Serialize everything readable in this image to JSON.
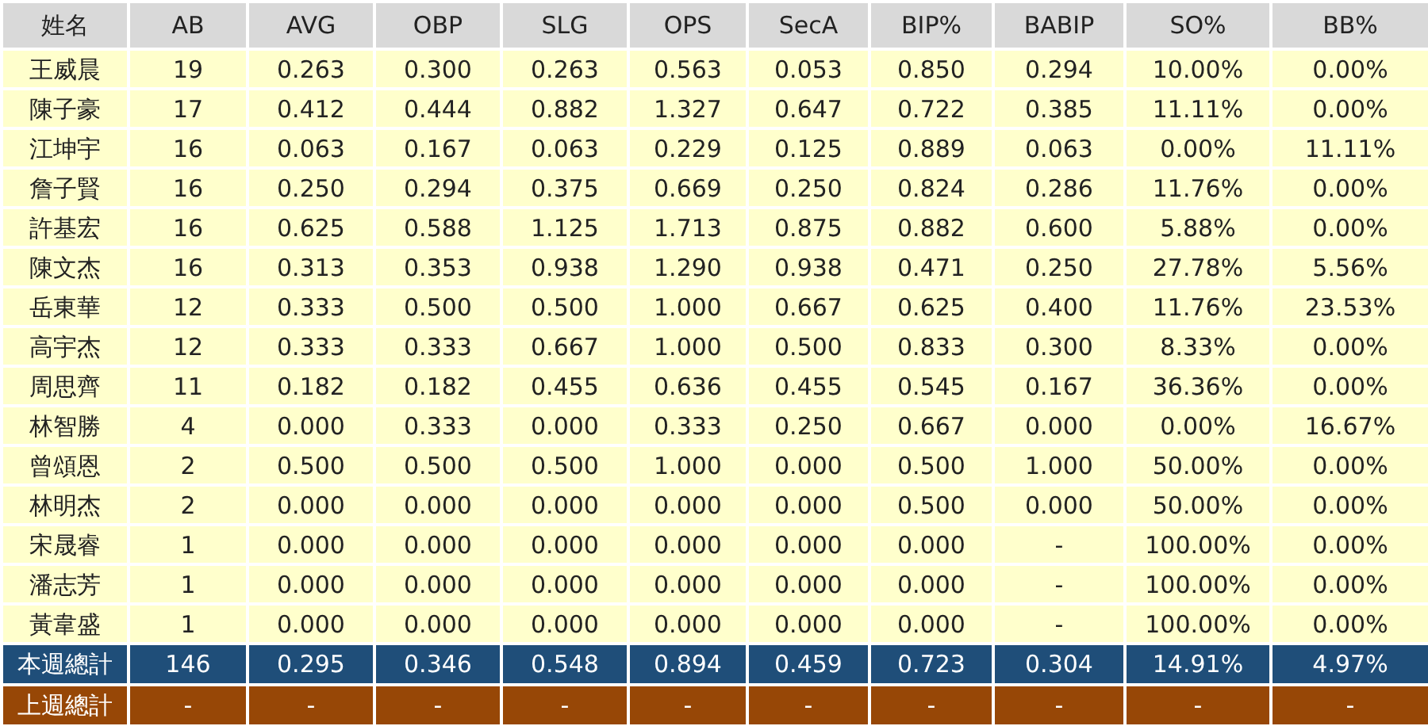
{
  "table": {
    "columns": [
      "姓名",
      "AB",
      "AVG",
      "OBP",
      "SLG",
      "OPS",
      "SecA",
      "BIP%",
      "BABIP",
      "SO%",
      "BB%"
    ],
    "rows": [
      [
        "王威晨",
        "19",
        "0.263",
        "0.300",
        "0.263",
        "0.563",
        "0.053",
        "0.850",
        "0.294",
        "10.00%",
        "0.00%"
      ],
      [
        "陳子豪",
        "17",
        "0.412",
        "0.444",
        "0.882",
        "1.327",
        "0.647",
        "0.722",
        "0.385",
        "11.11%",
        "0.00%"
      ],
      [
        "江坤宇",
        "16",
        "0.063",
        "0.167",
        "0.063",
        "0.229",
        "0.125",
        "0.889",
        "0.063",
        "0.00%",
        "11.11%"
      ],
      [
        "詹子賢",
        "16",
        "0.250",
        "0.294",
        "0.375",
        "0.669",
        "0.250",
        "0.824",
        "0.286",
        "11.76%",
        "0.00%"
      ],
      [
        "許基宏",
        "16",
        "0.625",
        "0.588",
        "1.125",
        "1.713",
        "0.875",
        "0.882",
        "0.600",
        "5.88%",
        "0.00%"
      ],
      [
        "陳文杰",
        "16",
        "0.313",
        "0.353",
        "0.938",
        "1.290",
        "0.938",
        "0.471",
        "0.250",
        "27.78%",
        "5.56%"
      ],
      [
        "岳東華",
        "12",
        "0.333",
        "0.500",
        "0.500",
        "1.000",
        "0.667",
        "0.625",
        "0.400",
        "11.76%",
        "23.53%"
      ],
      [
        "高宇杰",
        "12",
        "0.333",
        "0.333",
        "0.667",
        "1.000",
        "0.500",
        "0.833",
        "0.300",
        "8.33%",
        "0.00%"
      ],
      [
        "周思齊",
        "11",
        "0.182",
        "0.182",
        "0.455",
        "0.636",
        "0.455",
        "0.545",
        "0.167",
        "36.36%",
        "0.00%"
      ],
      [
        "林智勝",
        "4",
        "0.000",
        "0.333",
        "0.000",
        "0.333",
        "0.250",
        "0.667",
        "0.000",
        "0.00%",
        "16.67%"
      ],
      [
        "曾頌恩",
        "2",
        "0.500",
        "0.500",
        "0.500",
        "1.000",
        "0.000",
        "0.500",
        "1.000",
        "50.00%",
        "0.00%"
      ],
      [
        "林明杰",
        "2",
        "0.000",
        "0.000",
        "0.000",
        "0.000",
        "0.000",
        "0.500",
        "0.000",
        "50.00%",
        "0.00%"
      ],
      [
        "宋晟睿",
        "1",
        "0.000",
        "0.000",
        "0.000",
        "0.000",
        "0.000",
        "0.000",
        "-",
        "100.00%",
        "0.00%"
      ],
      [
        "潘志芳",
        "1",
        "0.000",
        "0.000",
        "0.000",
        "0.000",
        "0.000",
        "0.000",
        "-",
        "100.00%",
        "0.00%"
      ],
      [
        "黃韋盛",
        "1",
        "0.000",
        "0.000",
        "0.000",
        "0.000",
        "0.000",
        "0.000",
        "-",
        "100.00%",
        "0.00%"
      ]
    ],
    "totals": [
      {
        "kind": "this_week",
        "cells": [
          "本週總計",
          "146",
          "0.295",
          "0.346",
          "0.548",
          "0.894",
          "0.459",
          "0.723",
          "0.304",
          "14.91%",
          "4.97%"
        ]
      },
      {
        "kind": "last_week",
        "cells": [
          "上週總計",
          "-",
          "-",
          "-",
          "-",
          "-",
          "-",
          "-",
          "-",
          "-",
          "-"
        ]
      }
    ]
  }
}
